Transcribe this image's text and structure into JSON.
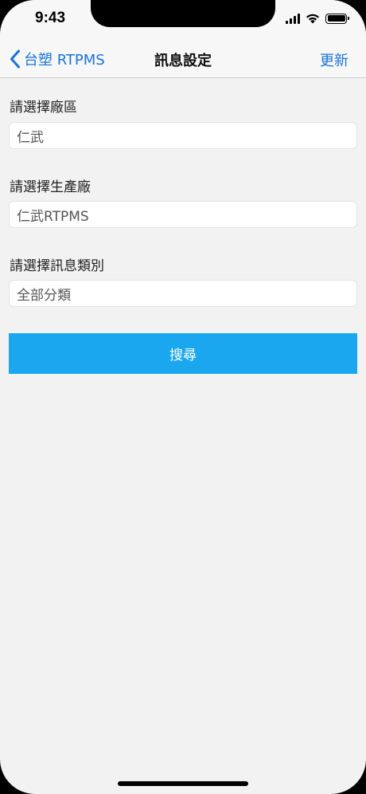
{
  "status_bar": {
    "time": "9:43"
  },
  "nav": {
    "back_label": "台塑 RTPMS",
    "title": "訊息設定",
    "refresh_label": "更新"
  },
  "form": {
    "fields": [
      {
        "label": "請選擇廠區",
        "value": "仁武"
      },
      {
        "label": "請選擇生產廠",
        "value": "仁武RTPMS"
      },
      {
        "label": "請選擇訊息類別",
        "value": "全部分類"
      }
    ],
    "search_label": "搜尋"
  },
  "colors": {
    "accent": "#1a73d9",
    "button": "#1ba7f0",
    "background": "#f2f2f2"
  }
}
